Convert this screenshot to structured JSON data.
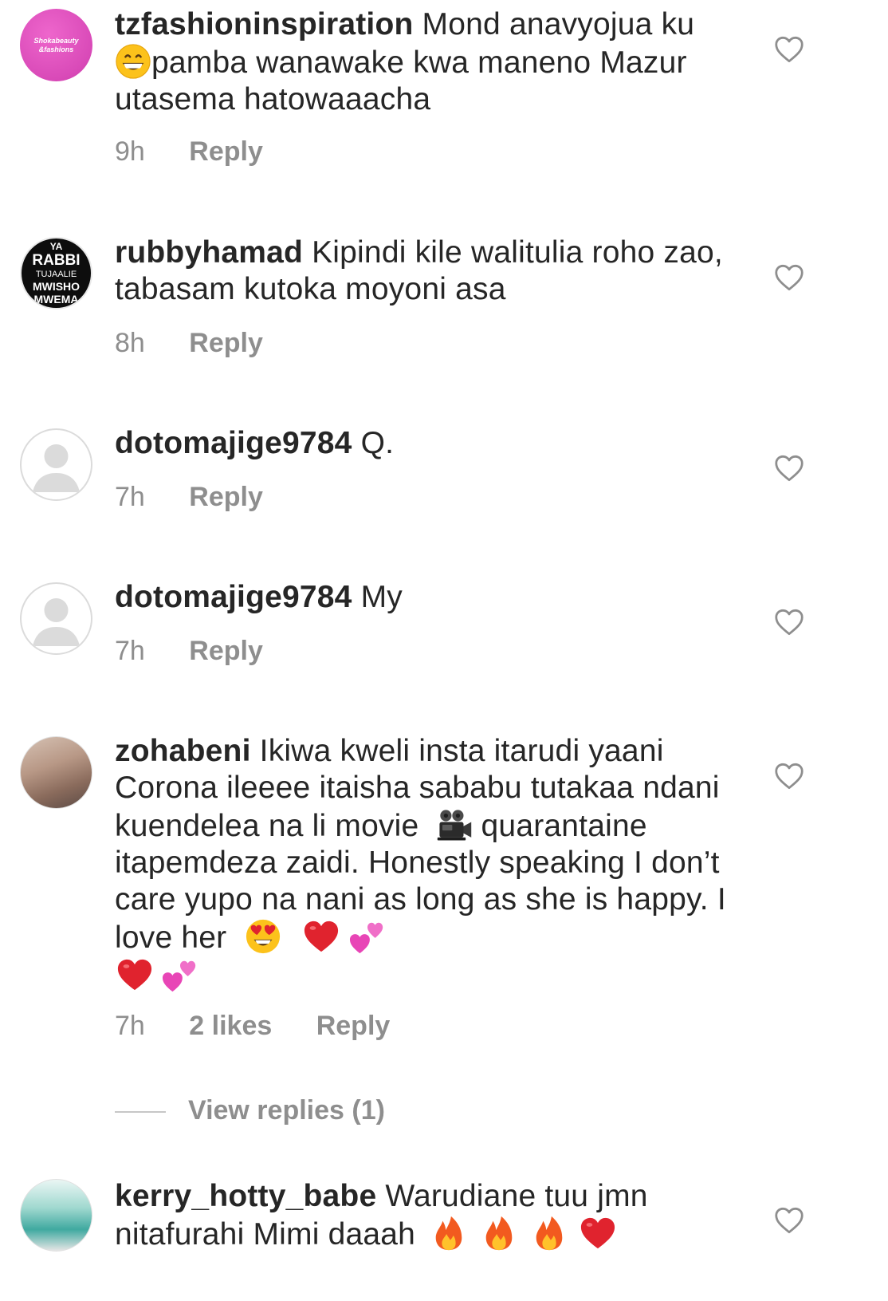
{
  "comments": [
    {
      "avatar_text": [
        "Shokabeauty",
        "&fashions"
      ],
      "username": "tzfashioninspiration",
      "text_a": "Mond anavyojua ku",
      "text_b": "pamba wanawake kwa maneno Mazur utasema hatowaaacha",
      "emoji_a": "grinning-face",
      "time": "9h",
      "reply": "Reply"
    },
    {
      "avatar_text": [
        "YA",
        "RABBI",
        "TUJAALIE",
        "MWISHO",
        "MWEMA"
      ],
      "username": "rubbyhamad",
      "text": "Kipindi kile walitulia roho zao, tabasam kutoka moyoni asa",
      "time": "8h",
      "reply": "Reply"
    },
    {
      "username": "dotomajige9784",
      "text": "Q.",
      "time": "7h",
      "reply": "Reply"
    },
    {
      "username": "dotomajige9784",
      "text": "My",
      "time": "7h",
      "reply": "Reply"
    },
    {
      "username": "zohabeni",
      "text_a": "Ikiwa kweli insta itarudi yaani Corona ileeee itaisha sababu tutakaa ndani kuendelea na li movie",
      "text_b": "quarantaine itapemdeza zaidi. Honestly speaking I don’t care yupo na nani as long as she is happy. I love her",
      "emojis_a": [
        "movie-camera"
      ],
      "emojis_b": [
        "heart-eyes",
        "red-heart",
        "two-hearts",
        "red-heart",
        "two-hearts"
      ],
      "time": "7h",
      "likes": "2 likes",
      "reply": "Reply",
      "view_replies": "View replies (1)"
    },
    {
      "username": "kerry_hotty_babe",
      "text": "Warudiane tuu jmn nitafurahi Mimi daaah",
      "emojis": [
        "fire",
        "fire",
        "fire",
        "red-heart"
      ]
    }
  ],
  "colors": {
    "username": "#262626",
    "text": "#262626",
    "meta": "#8e8e8e",
    "heart_outline": "#8e8e8e",
    "brand_avatar": "#d94ab8"
  },
  "icons": {
    "like": "heart-outline-icon",
    "default_avatar": "person-silhouette-icon"
  }
}
